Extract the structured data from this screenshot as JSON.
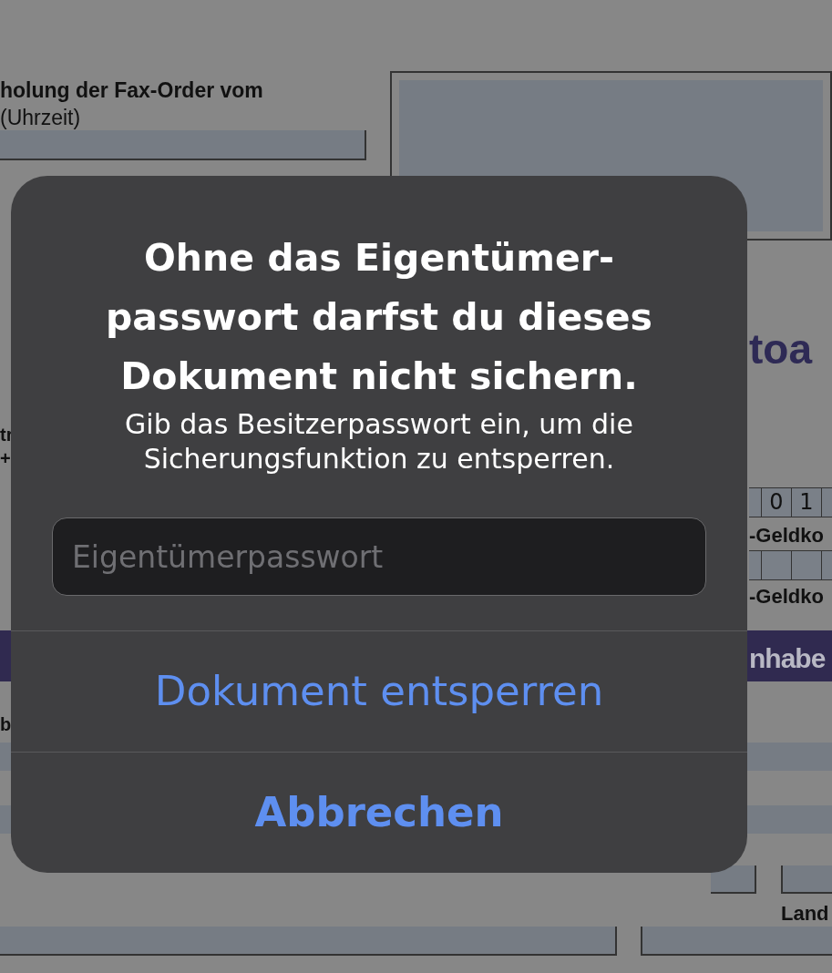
{
  "document": {
    "texts": [
      {
        "kind": "heading",
        "text": "holung der Fax-Order vom"
      },
      {
        "kind": "note",
        "text": "(Uhrzeit)"
      },
      {
        "kind": "small",
        "text": "tr"
      },
      {
        "kind": "small",
        "text": "+"
      },
      {
        "kind": "title",
        "text": "toa"
      },
      {
        "kind": "label",
        "text": "-Geldko"
      },
      {
        "kind": "label",
        "text": "-Geldko"
      },
      {
        "kind": "band",
        "text": "nhabe"
      },
      {
        "kind": "small",
        "text": "b"
      },
      {
        "kind": "label",
        "text": "Land"
      }
    ],
    "digits": [
      "0",
      "1"
    ]
  },
  "alert": {
    "title_lines": [
      "Ohne das Eigentümer-",
      "passwort darfst du dieses",
      "Dokument nicht sichern."
    ],
    "message_lines": [
      "Gib das Besitzerpasswort ein, um die",
      "Sicherungsfunktion zu entsperren."
    ],
    "field": {
      "placeholder": "Eigentümerpasswort"
    },
    "buttons": [
      {
        "label": "Dokument entsperren",
        "kind": "default"
      },
      {
        "label": "Abbrechen",
        "kind": "cancel"
      }
    ]
  }
}
